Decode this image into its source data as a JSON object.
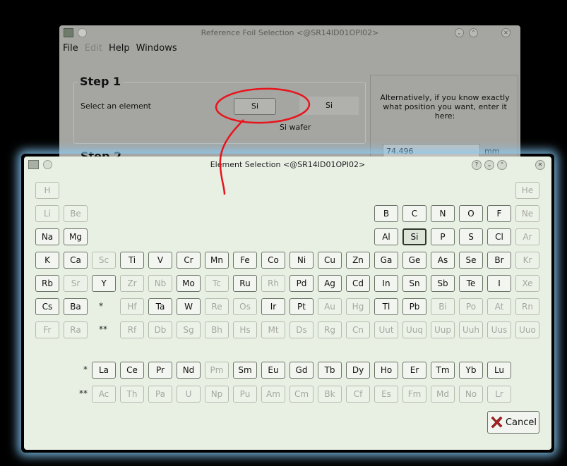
{
  "background_window": {
    "title": "Reference Foil Selection <@SR14ID01OPI02>",
    "menu": [
      "File",
      "Edit",
      "Help",
      "Windows"
    ],
    "step1_title": "Step 1",
    "select_label": "Select an element",
    "element_button": "Si",
    "element_field": "Si",
    "foil_name": "Si wafer",
    "alt_text": "Alternatively, if you know exactly what position you want, enter it here:",
    "position_value": "74.496",
    "position_unit": "mm",
    "step2_title": "Step 2"
  },
  "dialog": {
    "title": "Element Selection <@SR14ID01OPI02>",
    "cancel_label": "Cancel",
    "selected": "Si",
    "rows": [
      [
        {
          "s": "H",
          "e": 0
        },
        null,
        null,
        null,
        null,
        null,
        null,
        null,
        null,
        null,
        null,
        null,
        null,
        null,
        null,
        null,
        null,
        {
          "s": "He",
          "e": 0
        }
      ],
      [
        {
          "s": "Li",
          "e": 0
        },
        {
          "s": "Be",
          "e": 0
        },
        null,
        null,
        null,
        null,
        null,
        null,
        null,
        null,
        null,
        null,
        {
          "s": "B",
          "e": 1
        },
        {
          "s": "C",
          "e": 1
        },
        {
          "s": "N",
          "e": 1
        },
        {
          "s": "O",
          "e": 1
        },
        {
          "s": "F",
          "e": 1
        },
        {
          "s": "Ne",
          "e": 0
        }
      ],
      [
        {
          "s": "Na",
          "e": 1
        },
        {
          "s": "Mg",
          "e": 1
        },
        null,
        null,
        null,
        null,
        null,
        null,
        null,
        null,
        null,
        null,
        {
          "s": "Al",
          "e": 1
        },
        {
          "s": "Si",
          "e": 1
        },
        {
          "s": "P",
          "e": 1
        },
        {
          "s": "S",
          "e": 1
        },
        {
          "s": "Cl",
          "e": 1
        },
        {
          "s": "Ar",
          "e": 0
        }
      ],
      [
        {
          "s": "K",
          "e": 1
        },
        {
          "s": "Ca",
          "e": 1
        },
        {
          "s": "Sc",
          "e": 0
        },
        {
          "s": "Ti",
          "e": 1
        },
        {
          "s": "V",
          "e": 1
        },
        {
          "s": "Cr",
          "e": 1
        },
        {
          "s": "Mn",
          "e": 1
        },
        {
          "s": "Fe",
          "e": 1
        },
        {
          "s": "Co",
          "e": 1
        },
        {
          "s": "Ni",
          "e": 1
        },
        {
          "s": "Cu",
          "e": 1
        },
        {
          "s": "Zn",
          "e": 1
        },
        {
          "s": "Ga",
          "e": 1
        },
        {
          "s": "Ge",
          "e": 1
        },
        {
          "s": "As",
          "e": 1
        },
        {
          "s": "Se",
          "e": 1
        },
        {
          "s": "Br",
          "e": 1
        },
        {
          "s": "Kr",
          "e": 0
        }
      ],
      [
        {
          "s": "Rb",
          "e": 1
        },
        {
          "s": "Sr",
          "e": 0
        },
        {
          "s": "Y",
          "e": 1
        },
        {
          "s": "Zr",
          "e": 0
        },
        {
          "s": "Nb",
          "e": 0
        },
        {
          "s": "Mo",
          "e": 1
        },
        {
          "s": "Tc",
          "e": 0
        },
        {
          "s": "Ru",
          "e": 1
        },
        {
          "s": "Rh",
          "e": 0
        },
        {
          "s": "Pd",
          "e": 1
        },
        {
          "s": "Ag",
          "e": 1
        },
        {
          "s": "Cd",
          "e": 1
        },
        {
          "s": "In",
          "e": 1
        },
        {
          "s": "Sn",
          "e": 1
        },
        {
          "s": "Sb",
          "e": 1
        },
        {
          "s": "Te",
          "e": 1
        },
        {
          "s": "I",
          "e": 1
        },
        {
          "s": "Xe",
          "e": 0
        }
      ],
      [
        {
          "s": "Cs",
          "e": 1
        },
        {
          "s": "Ba",
          "e": 1
        },
        "*",
        {
          "s": "Hf",
          "e": 0
        },
        {
          "s": "Ta",
          "e": 1
        },
        {
          "s": "W",
          "e": 1
        },
        {
          "s": "Re",
          "e": 0
        },
        {
          "s": "Os",
          "e": 0
        },
        {
          "s": "Ir",
          "e": 1
        },
        {
          "s": "Pt",
          "e": 1
        },
        {
          "s": "Au",
          "e": 0
        },
        {
          "s": "Hg",
          "e": 0
        },
        {
          "s": "Tl",
          "e": 1
        },
        {
          "s": "Pb",
          "e": 1
        },
        {
          "s": "Bi",
          "e": 0
        },
        {
          "s": "Po",
          "e": 0
        },
        {
          "s": "At",
          "e": 0
        },
        {
          "s": "Rn",
          "e": 0
        }
      ],
      [
        {
          "s": "Fr",
          "e": 0
        },
        {
          "s": "Ra",
          "e": 0
        },
        "**",
        {
          "s": "Rf",
          "e": 0
        },
        {
          "s": "Db",
          "e": 0
        },
        {
          "s": "Sg",
          "e": 0
        },
        {
          "s": "Bh",
          "e": 0
        },
        {
          "s": "Hs",
          "e": 0
        },
        {
          "s": "Mt",
          "e": 0
        },
        {
          "s": "Ds",
          "e": 0
        },
        {
          "s": "Rg",
          "e": 0
        },
        {
          "s": "Cn",
          "e": 0
        },
        {
          "s": "Uut",
          "e": 0
        },
        {
          "s": "Uuq",
          "e": 0
        },
        {
          "s": "Uup",
          "e": 0
        },
        {
          "s": "Uuh",
          "e": 0
        },
        {
          "s": "Uus",
          "e": 0
        },
        {
          "s": "Uuo",
          "e": 0
        }
      ]
    ],
    "lanthanides": {
      "marker": "*",
      "items": [
        {
          "s": "La",
          "e": 1
        },
        {
          "s": "Ce",
          "e": 1
        },
        {
          "s": "Pr",
          "e": 1
        },
        {
          "s": "Nd",
          "e": 1
        },
        {
          "s": "Pm",
          "e": 0
        },
        {
          "s": "Sm",
          "e": 1
        },
        {
          "s": "Eu",
          "e": 1
        },
        {
          "s": "Gd",
          "e": 1
        },
        {
          "s": "Tb",
          "e": 1
        },
        {
          "s": "Dy",
          "e": 1
        },
        {
          "s": "Ho",
          "e": 1
        },
        {
          "s": "Er",
          "e": 1
        },
        {
          "s": "Tm",
          "e": 1
        },
        {
          "s": "Yb",
          "e": 1
        },
        {
          "s": "Lu",
          "e": 1
        }
      ]
    },
    "actinides": {
      "marker": "**",
      "items": [
        {
          "s": "Ac",
          "e": 0
        },
        {
          "s": "Th",
          "e": 0
        },
        {
          "s": "Pa",
          "e": 0
        },
        {
          "s": "U",
          "e": 0
        },
        {
          "s": "Np",
          "e": 0
        },
        {
          "s": "Pu",
          "e": 0
        },
        {
          "s": "Am",
          "e": 0
        },
        {
          "s": "Cm",
          "e": 0
        },
        {
          "s": "Bk",
          "e": 0
        },
        {
          "s": "Cf",
          "e": 0
        },
        {
          "s": "Es",
          "e": 0
        },
        {
          "s": "Fm",
          "e": 0
        },
        {
          "s": "Md",
          "e": 0
        },
        {
          "s": "No",
          "e": 0
        },
        {
          "s": "Lr",
          "e": 0
        }
      ]
    }
  },
  "colors": {
    "annotation": "#e8141c",
    "glow": "#87cefa",
    "dialog_bg": "#e8efe3"
  }
}
